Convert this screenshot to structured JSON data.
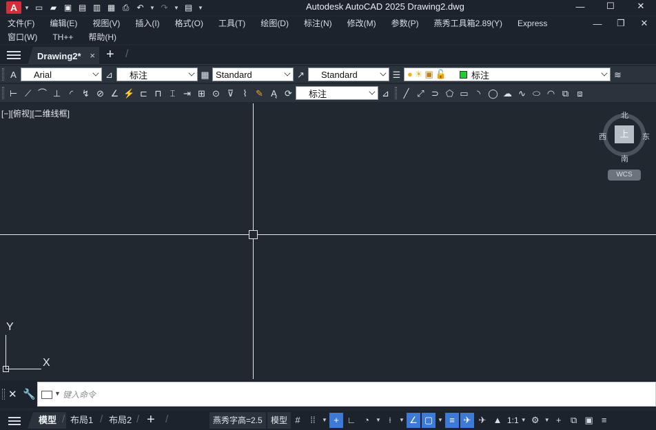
{
  "titlebar": {
    "app_logo": "A",
    "title": "Autodesk AutoCAD 2025    Drawing2.dwg",
    "quick_access": [
      "new-icon",
      "open-icon",
      "save-icon",
      "save-as-icon",
      "export-icon",
      "import-icon",
      "plot-icon",
      "undo-icon",
      "redo-icon",
      "workspace-icon"
    ]
  },
  "menubar": {
    "row1": [
      "文件(F)",
      "编辑(E)",
      "视图(V)",
      "插入(I)",
      "格式(O)",
      "工具(T)",
      "绘图(D)",
      "标注(N)",
      "修改(M)",
      "参数(P)",
      "燕秀工具箱2.89(Y)",
      "Express"
    ],
    "row2": [
      "窗口(W)",
      "TH++",
      "帮助(H)"
    ]
  },
  "tabs": {
    "document": "Drawing2*",
    "close": "×",
    "new": "+"
  },
  "toolbar1": {
    "text_style": "Arial",
    "dim_style": "标注",
    "table_style": "Standard",
    "multileader_style": "Standard",
    "layer": "标注",
    "layer_color": "#22cc33"
  },
  "toolbar2": {
    "dim_style": "标注"
  },
  "canvas": {
    "viewport_label": "[−][俯视][二维线框]",
    "viewcube": {
      "face": "上",
      "north": "北",
      "south": "南",
      "east": "东",
      "west": "西",
      "wcs": "WCS"
    },
    "ucs": {
      "x": "X",
      "y": "Y"
    }
  },
  "command": {
    "placeholder": "键入命令"
  },
  "statusbar": {
    "layout_tabs": [
      "模型",
      "布局1",
      "布局2"
    ],
    "text_height": "燕秀字高=2.5",
    "space": "模型",
    "scale": "1:1"
  },
  "colors": {
    "background": "#212830",
    "panel": "#1c232c",
    "toolbar": "#2b333d",
    "accent": "#3d7ad6",
    "logo": "#d32f3a"
  }
}
